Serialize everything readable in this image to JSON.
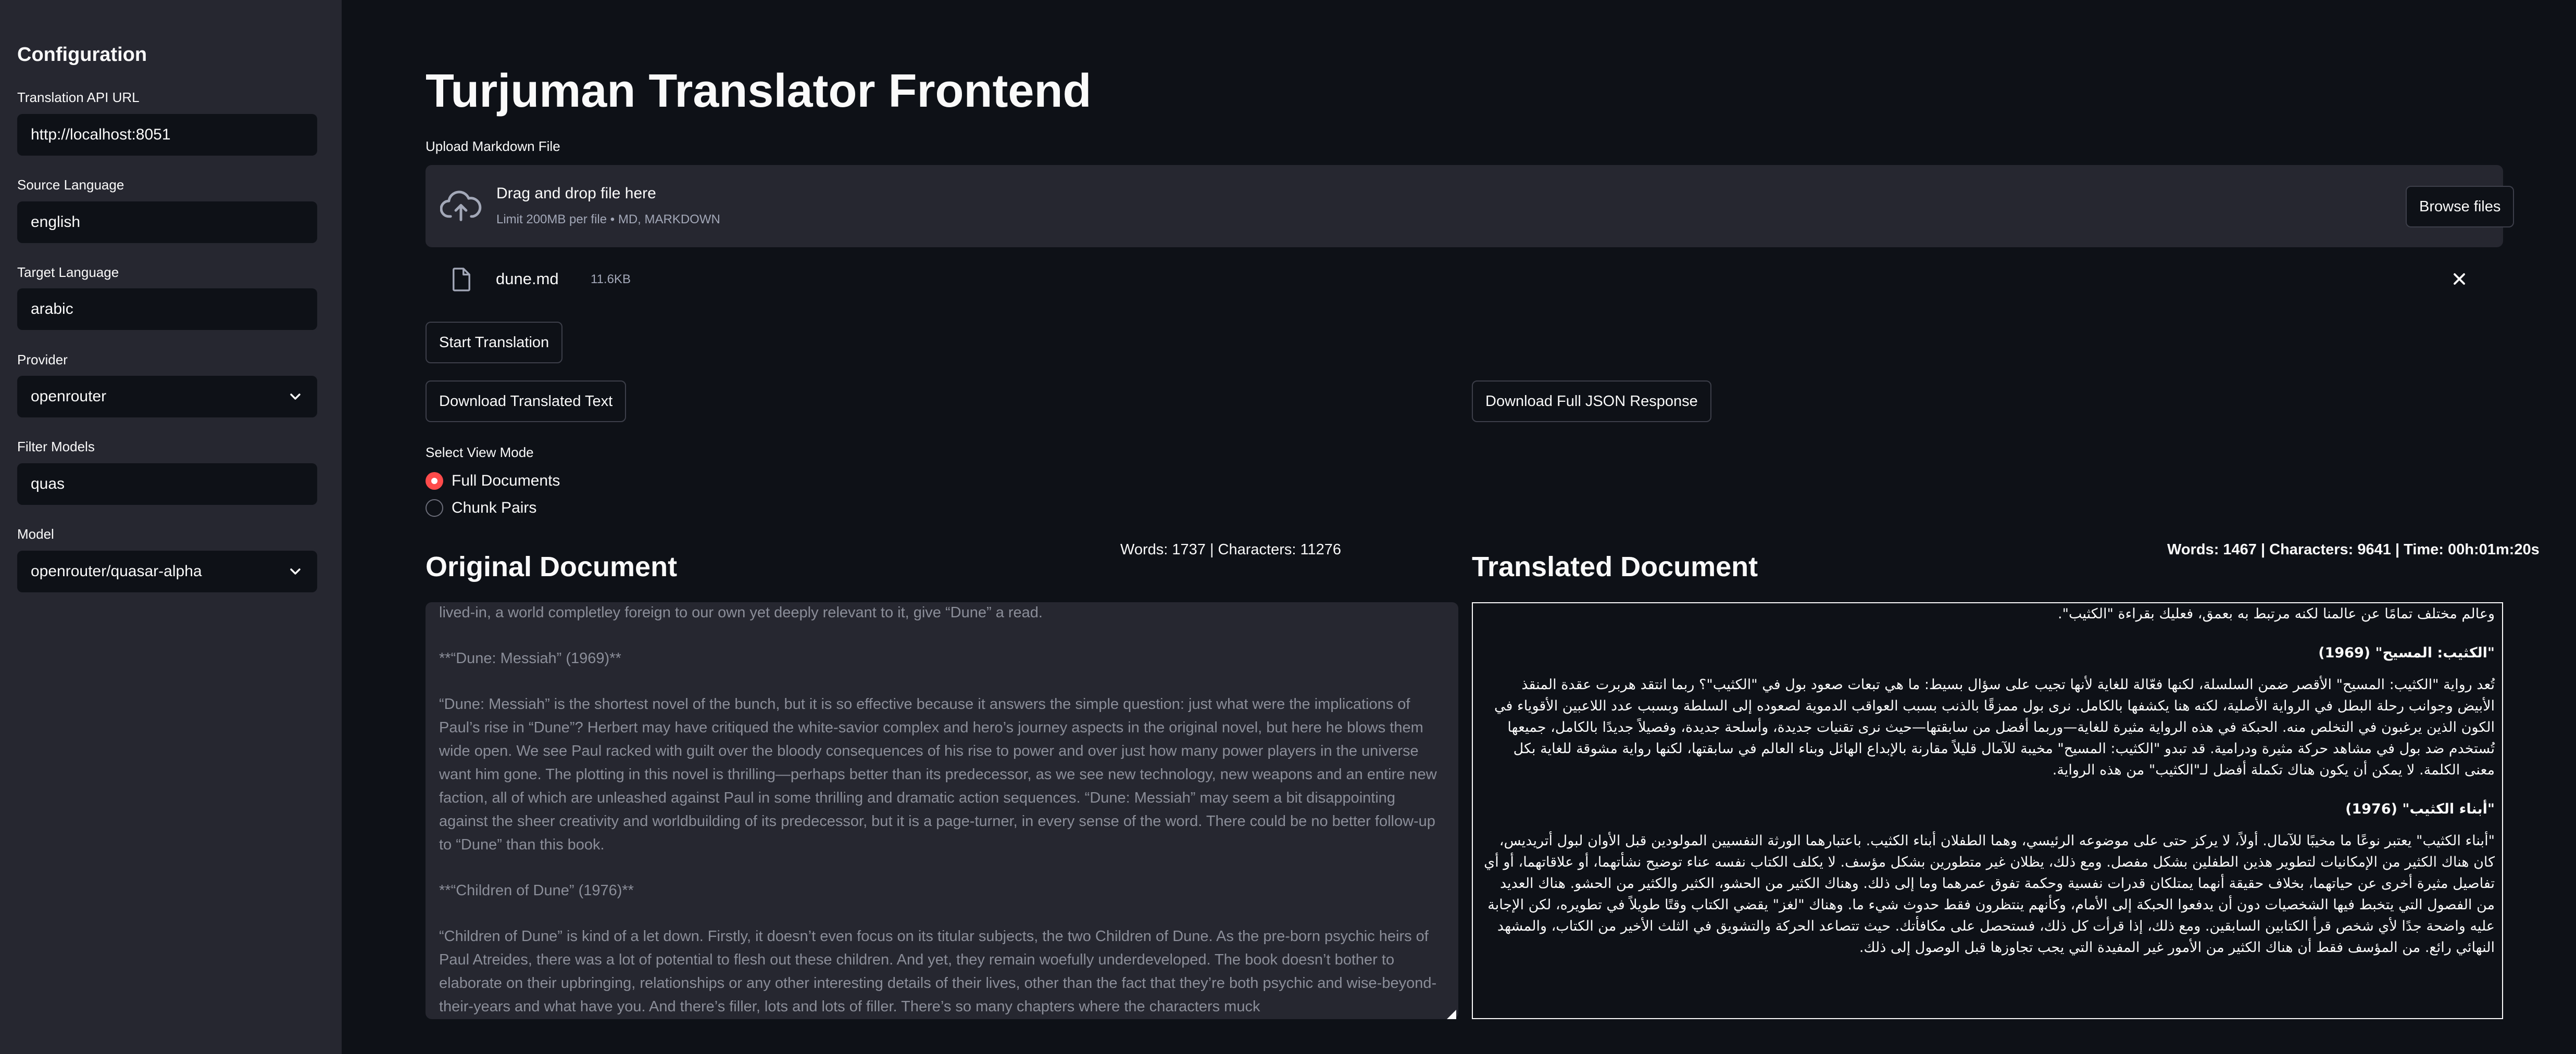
{
  "sidebar": {
    "title": "Configuration",
    "fields": [
      {
        "label": "Translation API URL",
        "value": "http://localhost:8051"
      },
      {
        "label": "Source Language",
        "value": "english"
      },
      {
        "label": "Target Language",
        "value": "arabic"
      },
      {
        "label": "Provider",
        "value": "openrouter"
      },
      {
        "label": "Filter Models",
        "value": "quas"
      },
      {
        "label": "Model",
        "value": "openrouter/quasar-alpha"
      }
    ]
  },
  "main": {
    "title": "Turjuman Translator Frontend",
    "upload": {
      "label": "Upload Markdown File",
      "drop_title": "Drag and drop file here",
      "drop_limit": "Limit 200MB per file • MD, MARKDOWN",
      "browse_label": "Browse files",
      "file_name": "dune.md",
      "file_size": "11.6KB"
    },
    "buttons": {
      "start": "Start Translation",
      "download_text": "Download Translated Text",
      "download_json": "Download Full JSON Response"
    },
    "view_mode": {
      "label": "Select View Mode",
      "options": [
        "Full Documents",
        "Chunk Pairs"
      ],
      "selected": "Full Documents"
    },
    "original": {
      "heading": "Original Document",
      "stats": "Words: 1737 | Characters: 11276",
      "paragraphs": [
        "lived-in, a world completley foreign to our own yet deeply relevant to it, give “Dune” a read.",
        "**“Dune: Messiah” (1969)**",
        "“Dune: Messiah” is the shortest novel of the bunch, but it is so effective because it answers the simple question: just what were the implications of Paul’s rise in “Dune”? Herbert may have critiqued the white-savior complex and hero’s journey aspects in the original novel, but here he blows them wide open. We see Paul racked with guilt over the bloody consequences of his rise to power and over just how many power players in the universe want him gone. The plotting in this novel is thrilling—perhaps better than its predecessor, as we see new technology, new weapons and an entire new faction, all of which are unleashed against Paul in some thrilling and dramatic action sequences. “Dune: Messiah” may seem a bit disappointing against the sheer creativity and worldbuilding of its predecessor, but it is a page-turner, in every sense of the word. There could be no better follow-up to “Dune” than this book.",
        "**“Children of Dune” (1976)**",
        "“Children of Dune” is kind of a let down. Firstly, it doesn’t even focus on its titular subjects, the two Children of Dune. As the pre-born psychic heirs of Paul Atreides, there was a lot of potential to flesh out these children. And yet, they remain woefully underdeveloped. The book doesn’t bother to elaborate on their upbringing, relationships or any other interesting details of their lives, other than the fact that they’re both psychic and wise-beyond-their-years and what have you. And there’s filler, lots and lots of filler. There’s so many chapters where the characters muck"
      ]
    },
    "translated": {
      "heading": "Translated Document",
      "stats": "Words: 1467  |  Characters: 9641  |  Time: 00h:01m:20s",
      "blocks": [
        {
          "type": "p",
          "text": "وعالم مختلف تمامًا عن عالمنا لكنه مرتبط به بعمق، فعليك بقراءة \"الكثيب\"."
        },
        {
          "type": "h",
          "text": "\"الكثيب: المسيح\" (1969)"
        },
        {
          "type": "p",
          "text": "تُعد رواية \"الكثيب: المسيح\" الأقصر ضمن السلسلة، لكنها فعّالة للغاية لأنها تجيب على سؤال بسيط: ما هي تبعات صعود بول في \"الكثيب\"؟ ربما انتقد هربرت عقدة المنقذ الأبيض وجوانب رحلة البطل في الرواية الأصلية، لكنه هنا يكشفها بالكامل. نرى بول ممزقًا بالذنب بسبب العواقب الدموية لصعوده إلى السلطة وبسبب عدد اللاعبين الأقوياء في الكون الذين يرغبون في التخلص منه. الحبكة في هذه الرواية مثيرة للغاية—وربما أفضل من سابقتها—حيث نرى تقنيات جديدة، وأسلحة جديدة، وفصيلاً جديدًا بالكامل، جميعها تُستخدم ضد بول في مشاهد حركة مثيرة ودرامية. قد تبدو \"الكثيب: المسيح\" مخيبة للآمال قليلاً مقارنة بالإبداع الهائل وبناء العالم في سابقتها، لكنها رواية مشوقة للغاية بكل معنى الكلمة. لا يمكن أن يكون هناك تكملة أفضل لـ\"الكثيب\" من هذه الرواية."
        },
        {
          "type": "h",
          "text": "\"أبناء الكثيب\" (1976)"
        },
        {
          "type": "p",
          "text": "\"أبناء الكثيب\" يعتبر نوعًا ما مخيبًا للآمال. أولاً، لا يركز حتى على موضوعه الرئيسي، وهما الطفلان أبناء الكثيب. باعتبارهما الورثة النفسيين المولودين قبل الأوان لبول أتريديس، كان هناك الكثير من الإمكانيات لتطوير هذين الطفلين بشكل مفصل. ومع ذلك، يظلان غير متطورين بشكل مؤسف. لا يكلف الكتاب نفسه عناء توضيح نشأتهما، أو علاقاتهما، أو أي تفاصيل مثيرة أخرى عن حياتهما، بخلاف حقيقة أنهما يمتلكان قدرات نفسية وحكمة تفوق عمرهما وما إلى ذلك. وهناك الكثير من الحشو، الكثير والكثير من الحشو. هناك العديد من الفصول التي يتخبط فيها الشخصيات دون أن يدفعوا الحبكة إلى الأمام، وكأنهم ينتظرون فقط حدوث شيء ما. وهناك \"لغز\" يقضي الكتاب وقتًا طويلاً في تطويره، لكن الإجابة عليه واضحة جدًا لأي شخص قرأ الكتابين السابقين. ومع ذلك، إذا قرأت كل ذلك، فستحصل على مكافأتك. حيث تتصاعد الحركة والتشويق في الثلث الأخير من الكتاب، والمشهد النهائي رائع. من المؤسف فقط أن هناك الكثير من الأمور غير المفيدة التي يجب تجاوزها قبل الوصول إلى ذلك."
        }
      ]
    }
  }
}
